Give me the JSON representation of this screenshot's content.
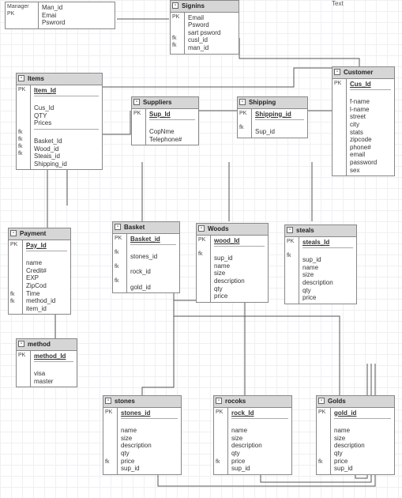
{
  "labels": {
    "text": "Text"
  },
  "entities": {
    "manager": {
      "title": "Manager",
      "pkcol": [
        "PK"
      ],
      "attrs": [
        "Man_id",
        "Emai",
        "Pswrord"
      ]
    },
    "signins": {
      "title": "Signins",
      "pkcol": [
        "PK",
        "",
        "",
        "fk",
        "fk"
      ],
      "attrs": [
        "Email",
        "Psword",
        "sart psword",
        "cusl_id",
        "man_id"
      ]
    },
    "customer": {
      "title": "Customer",
      "pkcol": [
        "PK"
      ],
      "pkattr": "Cus_Id",
      "attrs": [
        "f-name",
        "l-name",
        "street",
        "city",
        "stats",
        "zipcode",
        "phone#",
        "email",
        "password",
        "sex"
      ]
    },
    "items": {
      "title": "Items",
      "pkcol": [
        "PK"
      ],
      "pkattr": "Item_Id",
      "attrs": [
        "Cus_Id",
        "QTY",
        "Prices"
      ],
      "fks": [
        "Basket_Id",
        "Wood_id",
        "Steais_id",
        "Shipping_id"
      ],
      "fklabels": [
        "fk",
        "fk",
        "fk",
        "fk"
      ]
    },
    "suppliers": {
      "title": "Suppliers",
      "pkcol": [
        "PK"
      ],
      "pkattr": "Sup_Id",
      "attrs": [
        "CopNme",
        "Telephone#"
      ]
    },
    "shipping": {
      "title": "Shipping",
      "pkcol": [
        "PK"
      ],
      "pkattr": "Shipping_id",
      "fks": [
        "Sup_id"
      ],
      "fklabels": [
        "fk"
      ]
    },
    "payment": {
      "title": "Payment",
      "pkcol": [
        "PK"
      ],
      "pkattr": "Pay_Id",
      "attrs": [
        "name",
        "Credit#",
        "EXP",
        "ZipCod",
        "Time"
      ],
      "fks": [
        "method_id",
        "item_id"
      ],
      "fklabels": [
        "fk",
        "fk"
      ]
    },
    "basket": {
      "title": "Basket",
      "pkcol": [
        "PK"
      ],
      "pkattr": "Basket_id",
      "fks": [
        "stones_id",
        "rock_id",
        "gold_id"
      ],
      "fklabels": [
        "fk",
        "fk",
        "fk"
      ]
    },
    "woods": {
      "title": "Woods",
      "pkcol": [
        "PK"
      ],
      "pkattr": "wood_Id",
      "fks": [
        "sup_id"
      ],
      "fklabels": [
        "fk"
      ],
      "attrs": [
        "name",
        "size",
        "description",
        "qty",
        "price"
      ]
    },
    "steals": {
      "title": "steals",
      "pkcol": [
        "PK"
      ],
      "pkattr": "steals_Id",
      "fks": [
        "sup_id"
      ],
      "fklabels": [
        "fk"
      ],
      "attrs": [
        "name",
        "size",
        "description",
        "qty",
        "price"
      ]
    },
    "method": {
      "title": "method",
      "pkcol": [
        "PK"
      ],
      "pkattr": "method_Id",
      "attrs": [
        "visa",
        "master"
      ]
    },
    "stones": {
      "title": "stones",
      "pkcol": [
        "PK"
      ],
      "pkattr": "stones_id",
      "attrs": [
        "name",
        "size",
        "description",
        "qty",
        "price"
      ],
      "fks": [
        "sup_id"
      ],
      "fklabels": [
        "fk"
      ]
    },
    "rocks": {
      "title": "rocoks",
      "pkcol": [
        "PK"
      ],
      "pkattr": "rock_Id",
      "attrs": [
        "name",
        "size",
        "description",
        "qty",
        "price"
      ],
      "fks": [
        "sup_id"
      ],
      "fklabels": [
        "fk"
      ]
    },
    "golds": {
      "title": "Golds",
      "pkcol": [
        "PK"
      ],
      "pkattr": "gold_id",
      "attrs": [
        "name",
        "size",
        "description",
        "qty",
        "price"
      ],
      "fks": [
        "sup_id"
      ],
      "fklabels": [
        "fk"
      ]
    }
  }
}
